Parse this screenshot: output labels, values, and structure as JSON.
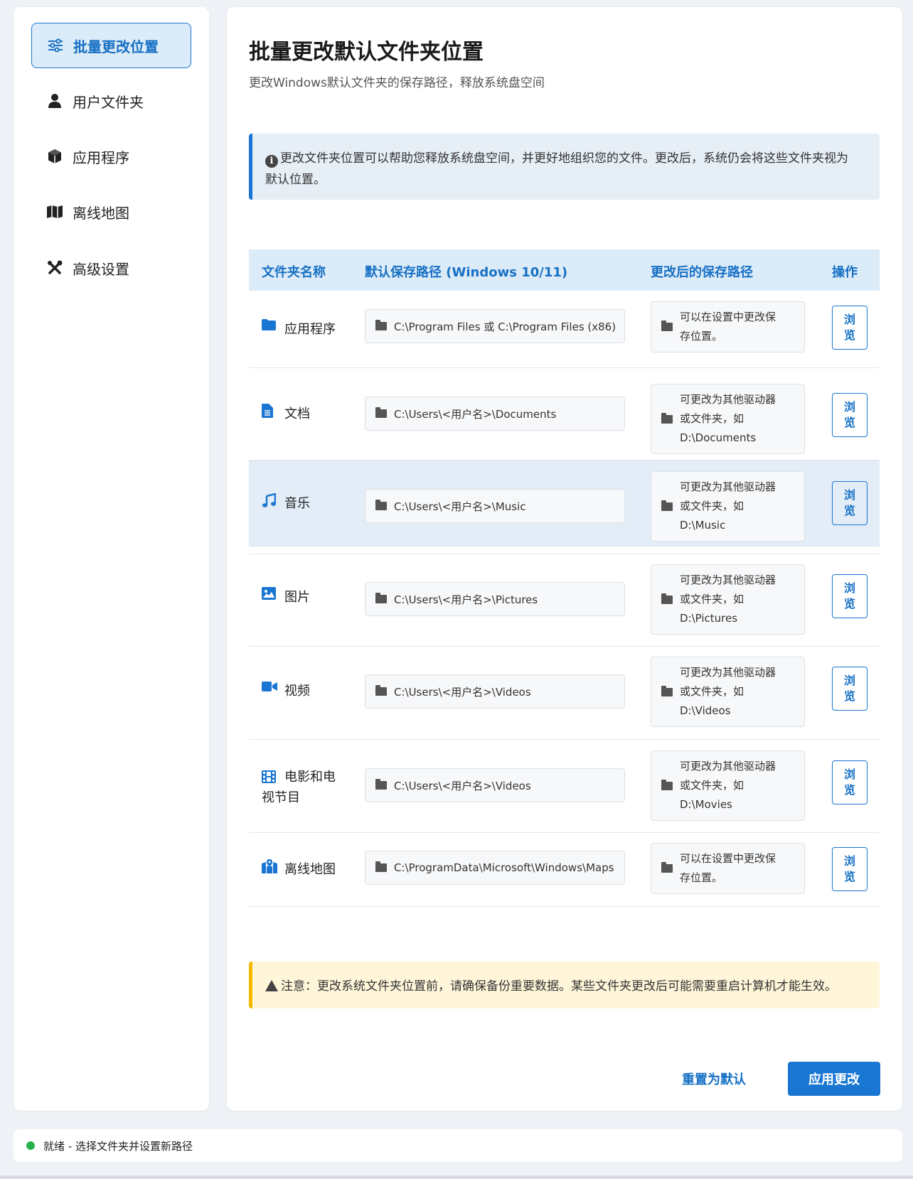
{
  "sidebar": {
    "items": [
      {
        "label": "批量更改位置",
        "icon": "sliders-icon",
        "active": true
      },
      {
        "label": "用户文件夹",
        "icon": "user-icon",
        "active": false
      },
      {
        "label": "应用程序",
        "icon": "cube-icon",
        "active": false
      },
      {
        "label": "离线地图",
        "icon": "map-icon",
        "active": false
      },
      {
        "label": "高级设置",
        "icon": "tools-icon",
        "active": false
      }
    ]
  },
  "main": {
    "title": "批量更改默认文件夹位置",
    "subtitle": "更改Windows默认文件夹的保存路径，释放系统盘空间",
    "info_line1": "更改文件夹位置可以帮助您释放系统盘空间，并更好地组织您的文件。更改后，系统仍会将这些文件夹视为",
    "info_line2": "默认位置。",
    "table": {
      "headers": {
        "name": "文件夹名称",
        "default_path": "默认保存路径 (Windows 10/11)",
        "new_path": "更改后的保存路径",
        "action": "操作"
      },
      "browse_label_1": "浏",
      "browse_label_2": "览",
      "rows": [
        {
          "name": "应用程序",
          "icon": "folder-icon",
          "default_path": "C:\\Program Files 或 C:\\Program Files (x86)",
          "new_l1": "可以在设置中更改保",
          "new_l2": "存位置。",
          "new_l3": ""
        },
        {
          "name": "文档",
          "icon": "document-icon",
          "default_path": "C:\\Users\\<用户名>\\Documents",
          "new_l1": "可更改为其他驱动器",
          "new_l2": "或文件夹，如",
          "new_l3": "D:\\Documents"
        },
        {
          "name": "音乐",
          "icon": "music-icon",
          "default_path": "C:\\Users\\<用户名>\\Music",
          "new_l1": "可更改为其他驱动器",
          "new_l2": "或文件夹，如",
          "new_l3": "D:\\Music"
        },
        {
          "name": "图片",
          "icon": "image-icon",
          "default_path": "C:\\Users\\<用户名>\\Pictures",
          "new_l1": "可更改为其他驱动器",
          "new_l2": "或文件夹，如",
          "new_l3": "D:\\Pictures"
        },
        {
          "name": "视频",
          "icon": "video-icon",
          "default_path": "C:\\Users\\<用户名>\\Videos",
          "new_l1": "可更改为其他驱动器",
          "new_l2": "或文件夹，如",
          "new_l3": "D:\\Videos"
        },
        {
          "name_l1": "电影和电",
          "name_l2": "视节目",
          "icon": "film-icon",
          "default_path": "C:\\Users\\<用户名>\\Videos",
          "new_l1": "可更改为其他驱动器",
          "new_l2": "或文件夹，如",
          "new_l3": "D:\\Movies"
        },
        {
          "name": "离线地图",
          "icon": "map-marker-icon",
          "default_path": "C:\\ProgramData\\Microsoft\\Windows\\Maps",
          "new_l1": "可以在设置中更改保",
          "new_l2": "存位置。",
          "new_l3": ""
        }
      ]
    },
    "warning": "注意：更改系统文件夹位置前，请确保备份重要数据。某些文件夹更改后可能需要重启计算机才能生效。",
    "reset_label": "重置为默认",
    "apply_label": "应用更改"
  },
  "status": {
    "text": "就绪 - 选择文件夹并设置新路径",
    "color": "#2ab24c"
  },
  "colors": {
    "accent": "#1976d2",
    "warning": "#f5b800"
  }
}
